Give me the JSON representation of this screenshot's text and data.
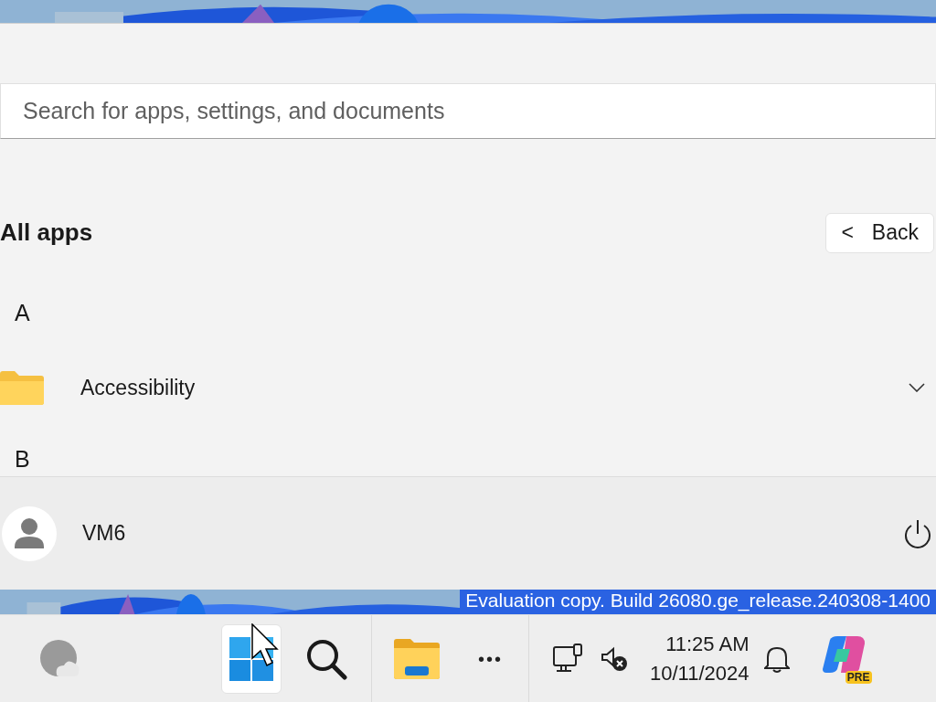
{
  "start_menu": {
    "search": {
      "placeholder": "Search for apps, settings, and documents"
    },
    "heading": "All apps",
    "back_button": {
      "label": "Back",
      "arrow": "<"
    },
    "groups": [
      {
        "letter": "A",
        "items": [
          {
            "name": "Accessibility",
            "kind": "folder",
            "expanded": false
          }
        ]
      },
      {
        "letter": "B"
      }
    ],
    "user": {
      "name": "VM6"
    }
  },
  "watermark": "Evaluation copy. Build 26080.ge_release.240308-1400",
  "taskbar": {
    "start_selected": true,
    "clock": {
      "time": "11:25 AM",
      "date": "10/11/2024"
    },
    "copilot_badge": "PRE",
    "more": "•••"
  }
}
